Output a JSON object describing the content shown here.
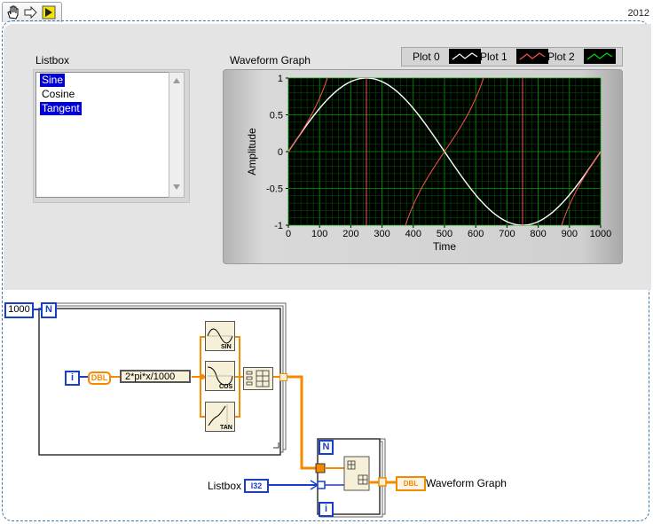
{
  "toolbar": {
    "icons": [
      "hand-icon",
      "arrow-icon",
      "run-icon"
    ]
  },
  "version": "2012",
  "listbox": {
    "label": "Listbox",
    "items": [
      {
        "text": "Sine",
        "selected": true
      },
      {
        "text": "Cosine",
        "selected": false
      },
      {
        "text": "Tangent",
        "selected": true
      }
    ]
  },
  "graph": {
    "label": "Waveform Graph",
    "legend": [
      "Plot 0",
      "Plot 1",
      "Plot 2"
    ],
    "colors": {
      "plot0": "#ffffff",
      "plot1": "#ff5050",
      "plot2": "#00e000",
      "background": "#000000",
      "grid": "#007a00"
    }
  },
  "chart_data": {
    "type": "line",
    "xlabel": "Time",
    "ylabel": "Amplitude",
    "xlim": [
      0,
      1000
    ],
    "ylim": [
      -1,
      1
    ],
    "x_ticks": [
      "0",
      "100",
      "200",
      "300",
      "400",
      "500",
      "600",
      "700",
      "800",
      "900",
      "1000"
    ],
    "y_ticks": [
      "1",
      "0.5",
      "0",
      "-0.5",
      "-1"
    ],
    "grid": true,
    "series": [
      {
        "name": "Plot 0",
        "function": "sin(2*pi*x/1000)",
        "color": "#ffffff"
      },
      {
        "name": "Plot 1",
        "function": "tan(2*pi*x/1000)",
        "color": "#ff5050"
      }
    ]
  },
  "diagram": {
    "loop_count": "1000",
    "loop_N": "N",
    "loop_i": "i",
    "dbl_label": "DBL",
    "formula": "2*pi*x/1000",
    "sin_label": "SIN",
    "cos_label": "COS",
    "tan_label": "TAN",
    "inner_N": "N",
    "inner_i": "i",
    "listbox_label": "Listbox",
    "i32_label": "I32",
    "graph_term_label": "DBL",
    "graph_name": "Waveform Graph"
  }
}
